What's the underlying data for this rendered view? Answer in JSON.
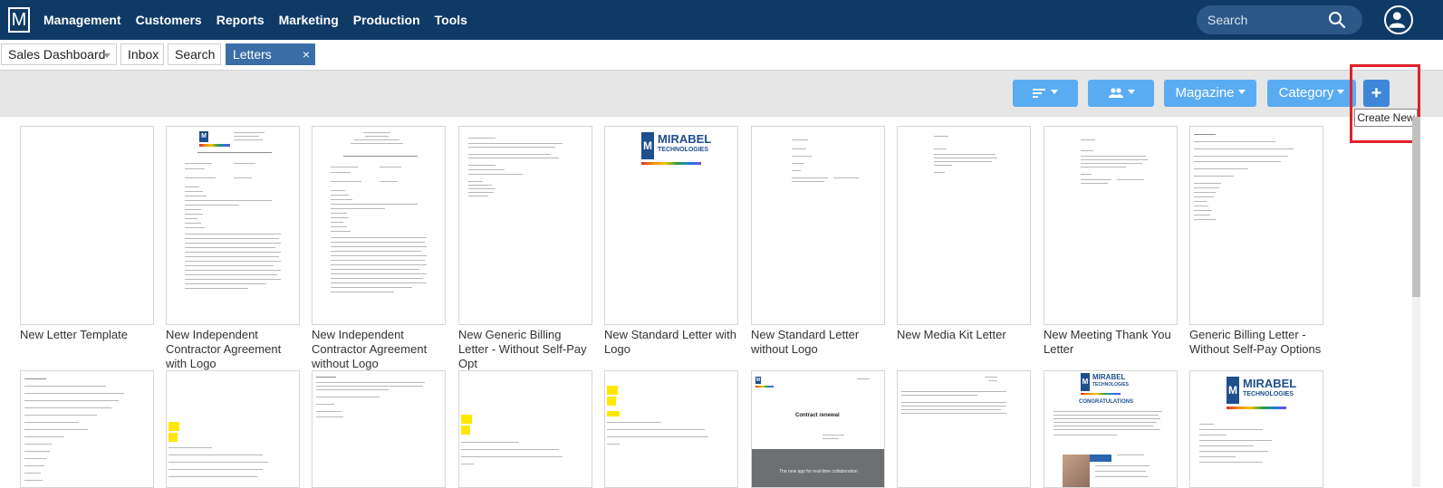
{
  "app": {
    "logo_letter": "M"
  },
  "nav": {
    "menu": [
      "Management",
      "Customers",
      "Reports",
      "Marketing",
      "Production",
      "Tools"
    ],
    "search_placeholder": "Search"
  },
  "tabs": {
    "dashboard": "Sales Dashboard",
    "inbox": "Inbox",
    "search": "Search",
    "letters": "Letters",
    "close": "×"
  },
  "toolbar": {
    "magazine": "Magazine",
    "category": "Category",
    "add": "+",
    "add_tooltip": "Create New"
  },
  "templates_row1": [
    "New Letter Template",
    "New Independent Contractor Agreement with Logo",
    "New Independent Contractor Agreement without Logo",
    "New Generic Billing Letter - Without Self-Pay Opt",
    "New Standard Letter with Logo",
    "New Standard Letter without Logo",
    "New Media Kit Letter",
    "New Meeting Thank You Letter",
    "Generic Billing Letter - Without Self-Pay Options"
  ],
  "thumbnail_text": {
    "mirabel": "MIRABEL",
    "technologies": "TECHNOLOGIES",
    "contract_renewal": "Contract renewal",
    "congratulations": "CONGRATULATIONS",
    "collab_tagline": "The new app for real-time collaboration"
  },
  "colors": {
    "nav_bg": "#0f3a66",
    "button_blue": "#5aacf2",
    "active_tab": "#3b6ea8",
    "highlight": "#e0202a"
  }
}
